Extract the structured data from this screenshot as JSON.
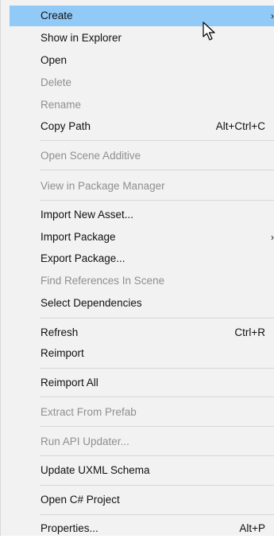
{
  "menu": {
    "items": [
      {
        "label": "Create",
        "shortcut": "",
        "submenu": true,
        "disabled": false,
        "highlighted": true
      },
      {
        "label": "Show in Explorer",
        "shortcut": "",
        "submenu": false,
        "disabled": false
      },
      {
        "label": "Open",
        "shortcut": "",
        "submenu": false,
        "disabled": false
      },
      {
        "label": "Delete",
        "shortcut": "",
        "submenu": false,
        "disabled": true
      },
      {
        "label": "Rename",
        "shortcut": "",
        "submenu": false,
        "disabled": true
      },
      {
        "label": "Copy Path",
        "shortcut": "Alt+Ctrl+C",
        "submenu": false,
        "disabled": false
      },
      {
        "label": "Open Scene Additive",
        "shortcut": "",
        "submenu": false,
        "disabled": true
      },
      {
        "label": "View in Package Manager",
        "shortcut": "",
        "submenu": false,
        "disabled": true
      },
      {
        "label": "Import New Asset...",
        "shortcut": "",
        "submenu": false,
        "disabled": false
      },
      {
        "label": "Import Package",
        "shortcut": "",
        "submenu": true,
        "disabled": false
      },
      {
        "label": "Export Package...",
        "shortcut": "",
        "submenu": false,
        "disabled": false
      },
      {
        "label": "Find References In Scene",
        "shortcut": "",
        "submenu": false,
        "disabled": true
      },
      {
        "label": "Select Dependencies",
        "shortcut": "",
        "submenu": false,
        "disabled": false
      },
      {
        "label": "Refresh",
        "shortcut": "Ctrl+R",
        "submenu": false,
        "disabled": false
      },
      {
        "label": "Reimport",
        "shortcut": "",
        "submenu": false,
        "disabled": false
      },
      {
        "label": "Reimport All",
        "shortcut": "",
        "submenu": false,
        "disabled": false
      },
      {
        "label": "Extract From Prefab",
        "shortcut": "",
        "submenu": false,
        "disabled": true
      },
      {
        "label": "Run API Updater...",
        "shortcut": "",
        "submenu": false,
        "disabled": true
      },
      {
        "label": "Update UXML Schema",
        "shortcut": "",
        "submenu": false,
        "disabled": false
      },
      {
        "label": "Open C# Project",
        "shortcut": "",
        "submenu": false,
        "disabled": false
      },
      {
        "label": "Properties...",
        "shortcut": "Alt+P",
        "submenu": false,
        "disabled": false
      }
    ],
    "submenu_glyph": "›"
  },
  "colors": {
    "background": "#f2f2f2",
    "highlight": "#91c9f7",
    "text": "#111111",
    "disabled_text": "#8f8f8f",
    "separator": "#d7d7d7"
  },
  "icons": {
    "cursor": "mouse-pointer-icon",
    "submenu": "chevron-right-icon"
  }
}
